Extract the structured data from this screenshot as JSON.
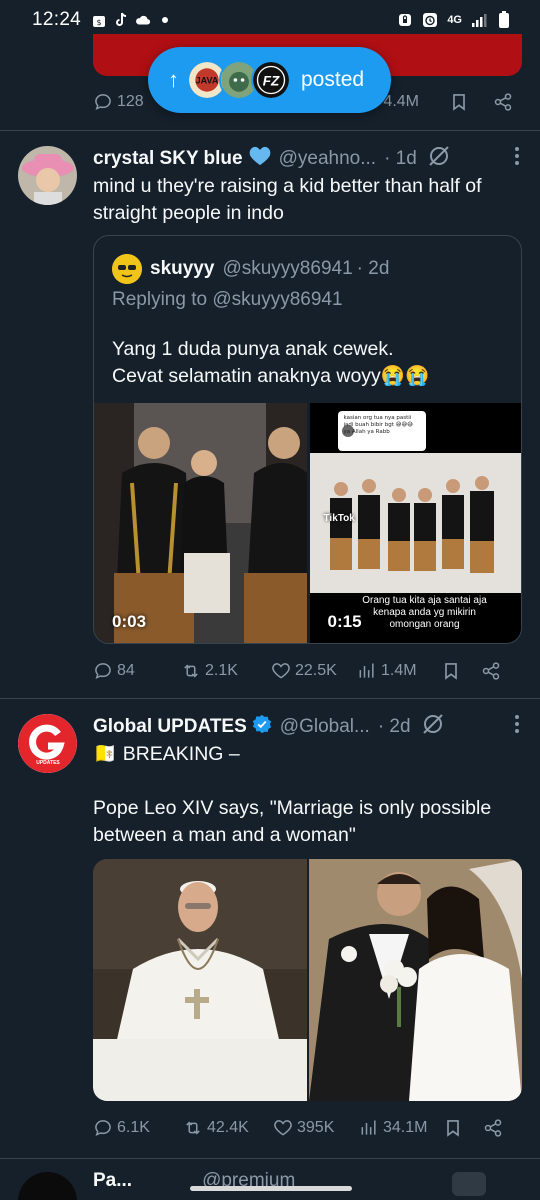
{
  "status_bar": {
    "time": "12:24",
    "network": "4G"
  },
  "previous_tweet": {
    "replies": "128",
    "views": "4.4M"
  },
  "new_posts_pill": {
    "label": "posted",
    "avatar1_text": "JAVA",
    "avatar3_text": "FZ"
  },
  "tweet1": {
    "name": "crystal SKY blue",
    "handle": "@yeahno...",
    "time": "· 1d",
    "text_line1": "mind u they're raising a kid better than half of",
    "text_line2": "straight people in indo",
    "quote": {
      "name": "skuyyy",
      "handle": "@skuyyy86941",
      "time": "· 2d",
      "replying_to": "Replying to @skuyyy86941",
      "text_line1": "Yang 1 duda punya anak cewek.",
      "text_line2": "Cevat selamatin anaknya woyy😭😭",
      "video1_duration": "0:03",
      "video2_duration": "0:15",
      "video2_top_caption": "kasian org tua nya pastii jadi buah bibir bgt 😅😅😅 ya Allah ya Rabb",
      "video2_tiktok": "TikTok",
      "video2_caption_line1": "Orang tua kita aja santai aja",
      "video2_caption_line2": "kenapa anda yg mikirin",
      "video2_caption_line3": "omongan orang"
    },
    "stats": {
      "replies": "84",
      "reposts": "2.1K",
      "likes": "22.5K",
      "views": "1.4M"
    }
  },
  "tweet2": {
    "name": "Global UPDATES",
    "handle": "@Global...",
    "time": "· 2d",
    "avatar_text": "UPDATES",
    "text_line1": "🇻🇦 BREAKING –",
    "text_line2": "Pope Leo XIV says, \"Marriage is only possible",
    "text_line3": "between a man and a woman\"",
    "stats": {
      "replies": "6.1K",
      "reposts": "42.4K",
      "likes": "395K",
      "views": "34.1M"
    }
  },
  "next_tweet": {
    "name_partial": "Pa...",
    "handle_partial": "@premium"
  },
  "colors": {
    "background": "#15202b",
    "accent": "#1d9bf0",
    "verified": "#1d9bf0",
    "secondary_text": "#8b98a5",
    "divider": "#38444d"
  }
}
